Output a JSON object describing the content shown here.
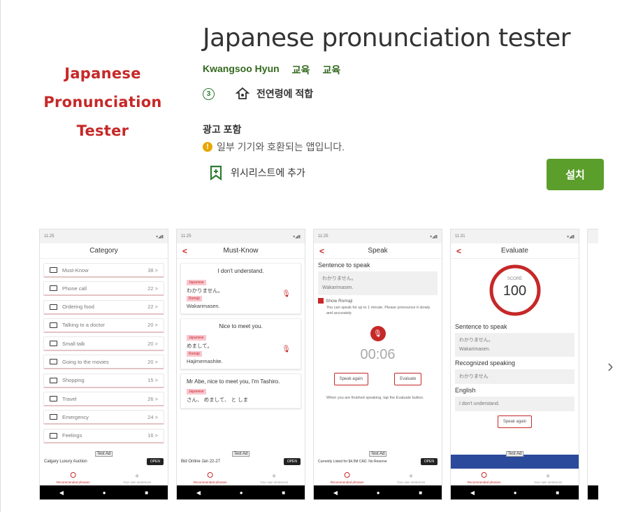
{
  "app": {
    "logo_lines": [
      "Japanese",
      "Pronunciation",
      "Tester"
    ],
    "title": "Japanese pronunciation tester",
    "developer": "Kwangsoo Hyun",
    "categories": [
      "교육",
      "교육"
    ],
    "content_rating_badge": "3",
    "content_rating_text": "전연령에 적합",
    "ads_label": "광고 포함",
    "compat_text": "일부 기기와 호환되는 앱입니다.",
    "wishlist_label": "위시리스트에 추가",
    "install_label": "설치"
  },
  "colors": {
    "accent": "#c62828",
    "install": "#5c9e2c",
    "developer": "#33691e"
  },
  "shots": {
    "status_time_1": "11:25",
    "status_time_4": "11:31",
    "category": {
      "title": "Category",
      "items": [
        {
          "label": "Must-Know",
          "count": "38 >"
        },
        {
          "label": "Phone call",
          "count": "22 >"
        },
        {
          "label": "Ordering food",
          "count": "22 >"
        },
        {
          "label": "Talking to a doctor",
          "count": "20 >"
        },
        {
          "label": "Small talk",
          "count": "20 >"
        },
        {
          "label": "Going to the movies",
          "count": "20 >"
        },
        {
          "label": "Shopping",
          "count": "15 >"
        },
        {
          "label": "Travel",
          "count": "26 >"
        },
        {
          "label": "Emergency",
          "count": "24 >"
        },
        {
          "label": "Feelings",
          "count": "16 >"
        }
      ],
      "ad_text": "Calgary Luxury Auction",
      "ad_open": "OPEN",
      "test_ad": "Test Ad"
    },
    "mustknow": {
      "title": "Must-Know",
      "cards": [
        {
          "en": "I don't understand.",
          "jp_chip": "Japanese",
          "jp": "わかりません。",
          "ro_chip": "Romaji",
          "ro": "Wakarimasen."
        },
        {
          "en": "Nice to meet you.",
          "jp_chip": "Japanese",
          "jp": "めまして。",
          "ro_chip": "Romaji",
          "ro": "Hajimemashite."
        },
        {
          "en": "Mr Abe, nice to meet you, I'm Tashiro.",
          "jp_chip": "Japanese",
          "jp": "さん、 めまして、 と しま",
          "ro_chip": "",
          "ro": ""
        }
      ],
      "ad_text": "Bid Online Jan 22-27",
      "ad_open": "OPEN",
      "test_ad": "Test Ad"
    },
    "speak": {
      "title": "Speak",
      "label": "Sentence to speak",
      "jp": "わかりません。",
      "ro": "Wakarimasen.",
      "show_romaji": "Show Romaji",
      "hint": "You can speak for up to 1 minute. Please pronounce it slowly and accurately.",
      "timer": "00:06",
      "speak_again": "Speak again",
      "evaluate": "Evaluate",
      "finish_hint": "When you are finished speaking, tap the Evaluate button.",
      "ad_text": "Currently Listed for $4.5M CAD. No Reserve",
      "ad_open": "OPEN",
      "test_ad": "Test Ad"
    },
    "evaluate": {
      "title": "Evaluate",
      "score_label": "SCORE",
      "score": "100",
      "sentence_label": "Sentence to speak",
      "jp": "わかりません。",
      "ro": "Wakarimasen.",
      "recognized_label": "Recognized speaking",
      "recognized": "わかりません",
      "english_label": "English",
      "english": "I don't understand.",
      "speak_again": "Speak again",
      "test_ad": "Test Ad"
    },
    "tabs": {
      "rec": "Recommended phrases",
      "own": "Your own sentences"
    }
  }
}
